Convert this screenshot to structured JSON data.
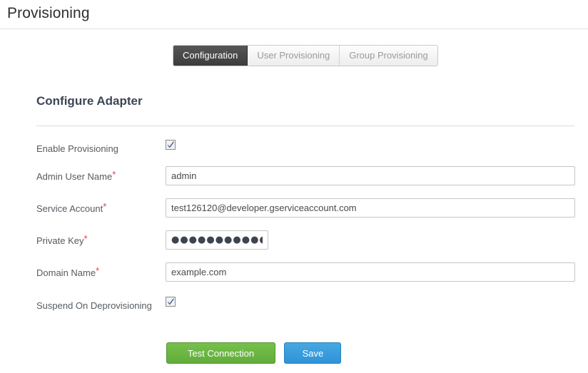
{
  "header": {
    "title": "Provisioning"
  },
  "tabs": [
    {
      "label": "Configuration",
      "active": true,
      "name": "tab-configuration"
    },
    {
      "label": "User Provisioning",
      "active": false,
      "name": "tab-user-provisioning"
    },
    {
      "label": "Group Provisioning",
      "active": false,
      "name": "tab-group-provisioning"
    }
  ],
  "section": {
    "title": "Configure Adapter"
  },
  "fields": [
    {
      "name": "enable-provisioning",
      "label": "Enable Provisioning",
      "required": false,
      "type": "checkbox",
      "checked": true
    },
    {
      "name": "admin-user-name",
      "label": "Admin User Name",
      "required": true,
      "type": "text",
      "value": "admin",
      "placeholder": ""
    },
    {
      "name": "service-account",
      "label": "Service Account",
      "required": true,
      "type": "text",
      "value": "test126120@developer.gserviceaccount.com",
      "placeholder": ""
    },
    {
      "name": "private-key",
      "label": "Private Key",
      "required": true,
      "type": "password",
      "value": "●●●●●●●●●●●●●●●●●",
      "placeholder": ""
    },
    {
      "name": "domain-name",
      "label": "Domain Name",
      "required": true,
      "type": "text",
      "value": "example.com",
      "placeholder": ""
    },
    {
      "name": "suspend-on-deprovisioning",
      "label": "Suspend On Deprovisioning",
      "required": false,
      "type": "checkbox",
      "checked": true
    }
  ],
  "buttons": {
    "test_connection_label": "Test Connection",
    "save_label": "Save"
  },
  "required_marker": "*",
  "colors": {
    "accent_green": "#62ac3b",
    "accent_blue": "#2f93d6",
    "required_red": "#d6434a",
    "active_tab_bg": "#3c3c3c",
    "heading": "#3b4556"
  }
}
